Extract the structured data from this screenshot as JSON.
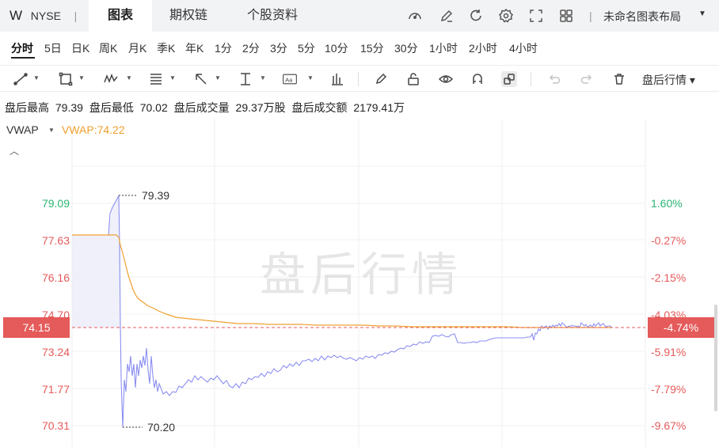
{
  "header": {
    "symbol": "W",
    "exchange": "NYSE",
    "separator": "|",
    "tabs": [
      "图表",
      "期权链",
      "个股资料"
    ],
    "layout_separator": "|",
    "layout_name": "未命名图表布局",
    "icons": [
      "speedometer-icon",
      "pencil-icon",
      "refresh-icon",
      "gear-icon",
      "fullscreen-icon",
      "grid-icon"
    ]
  },
  "periods": {
    "items": [
      "分时",
      "5日",
      "日K",
      "周K",
      "月K",
      "季K",
      "年K",
      "1分",
      "2分",
      "3分",
      "5分",
      "10分",
      "15分",
      "30分",
      "1小时",
      "2小时",
      "4小时"
    ],
    "active": "分时",
    "session_select": "盘后行情 ▾"
  },
  "stats": {
    "high_label": "盘后最高",
    "high": "79.39",
    "low_label": "盘后最低",
    "low": "70.02",
    "vol_label": "盘后成交量",
    "vol": "29.37万股",
    "amt_label": "盘后成交额",
    "amt": "2179.41万"
  },
  "indicator": {
    "name": "VWAP",
    "caret": "▼",
    "value_text": "VWAP:74.22",
    "collapse": "︿"
  },
  "chart": {
    "watermark": "盘后行情",
    "left_ticks": [
      "79.09",
      "77.63",
      "76.16",
      "74.70",
      "73.24",
      "71.77",
      "70.31"
    ],
    "right_ticks": [
      "1.60%",
      "-0.27%",
      "-2.15%",
      "-4.03%",
      "-5.91%",
      "-7.79%",
      "-9.67%"
    ],
    "current_price": "74.15",
    "current_pct": "-4.74%",
    "high_marker": "79.39",
    "low_marker": "70.20",
    "colors": {
      "up": "#2bb673",
      "down": "#e55a5a",
      "price_line": "#8c8ff0",
      "vwap_line": "#f0a030",
      "ref_line": "#e55a5a"
    }
  }
}
